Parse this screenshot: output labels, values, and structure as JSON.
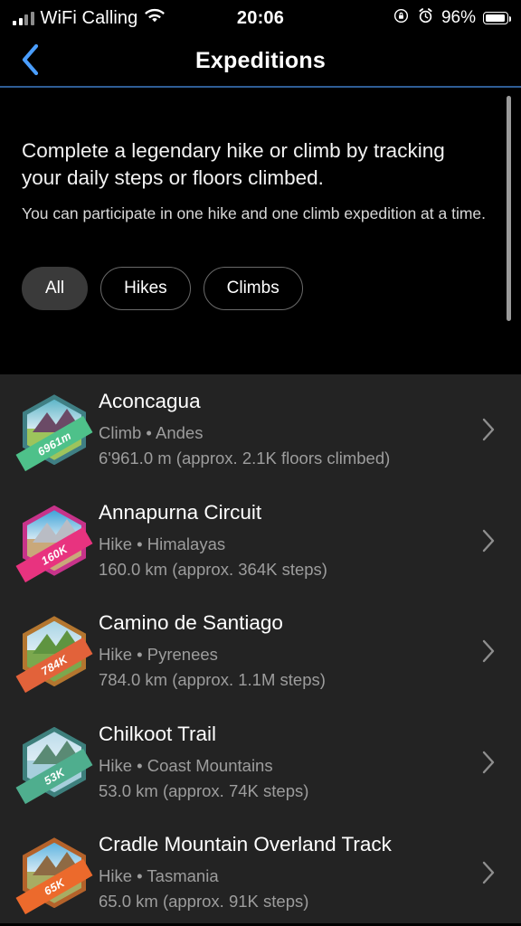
{
  "status_bar": {
    "signal_icon": "cellular-bars-icon",
    "carrier": "WiFi Calling",
    "wifi_icon": "wifi-icon",
    "time": "20:06",
    "rotation_lock_icon": "rotation-lock-icon",
    "alarm_icon": "alarm-clock-icon",
    "battery_percent": "96%",
    "battery_icon": "battery-icon"
  },
  "nav": {
    "back_icon": "chevron-left-icon",
    "title": "Expeditions",
    "accent_color": "#4a9eff",
    "separator_color": "#2f5d96"
  },
  "header": {
    "title": "Complete a legendary hike or climb by tracking your daily steps or floors climbed.",
    "subtitle": "You can participate in one hike and one climb expedition at a time.",
    "background_color": "#000000"
  },
  "filters": {
    "selected": "All",
    "chips": [
      {
        "label": "All",
        "selected": true
      },
      {
        "label": "Hikes",
        "selected": false
      },
      {
        "label": "Climbs",
        "selected": false
      }
    ]
  },
  "scrollbar": {
    "present": true,
    "color": "#9a9a9a"
  },
  "list": {
    "background_color": "#232323",
    "chevron_icon": "chevron-right-icon",
    "items": [
      {
        "name": "Aconcagua",
        "meta": "Climb • Andes",
        "stat": "6'961.0 m (approx. 2.1K floors climbed)",
        "badge_label": "6961m",
        "badge_border": "#3f7f84",
        "badge_sky": "#5fb6c8",
        "badge_ground": "#9dc45c",
        "badge_peak": "#6b4a66",
        "ribbon_color": "#4ec18a"
      },
      {
        "name": "Annapurna Circuit",
        "meta": "Hike • Himalayas",
        "stat": "160.0 km (approx. 364K steps)",
        "badge_label": "160K",
        "badge_border": "#c7338a",
        "badge_sky": "#3ea3d8",
        "badge_ground": "#c9a87a",
        "badge_peak": "#b9bcc4",
        "ribbon_color": "#e8337f"
      },
      {
        "name": "Camino de Santiago",
        "meta": "Hike • Pyrenees",
        "stat": "784.0 km (approx. 1.1M steps)",
        "badge_label": "784K",
        "badge_border": "#b4762f",
        "badge_sky": "#a8d4e4",
        "badge_ground": "#7ba84e",
        "badge_peak": "#5f9440",
        "ribbon_color": "#e2623a"
      },
      {
        "name": "Chilkoot Trail",
        "meta": "Hike • Coast Mountains",
        "stat": "53.0 km (approx. 74K steps)",
        "badge_label": "53K",
        "badge_border": "#3d7f7c",
        "badge_sky": "#bcdcea",
        "badge_ground": "#a7cfdc",
        "badge_peak": "#5a8a74",
        "ribbon_color": "#4fae8e"
      },
      {
        "name": "Cradle Mountain Overland Track",
        "meta": "Hike • Tasmania",
        "stat": "65.0 km (approx. 91K steps)",
        "badge_label": "65K",
        "badge_border": "#b4622a",
        "badge_sky": "#5fb4e0",
        "badge_ground": "#a8ac63",
        "badge_peak": "#8e6a44",
        "ribbon_color": "#ec6a2c"
      }
    ]
  }
}
